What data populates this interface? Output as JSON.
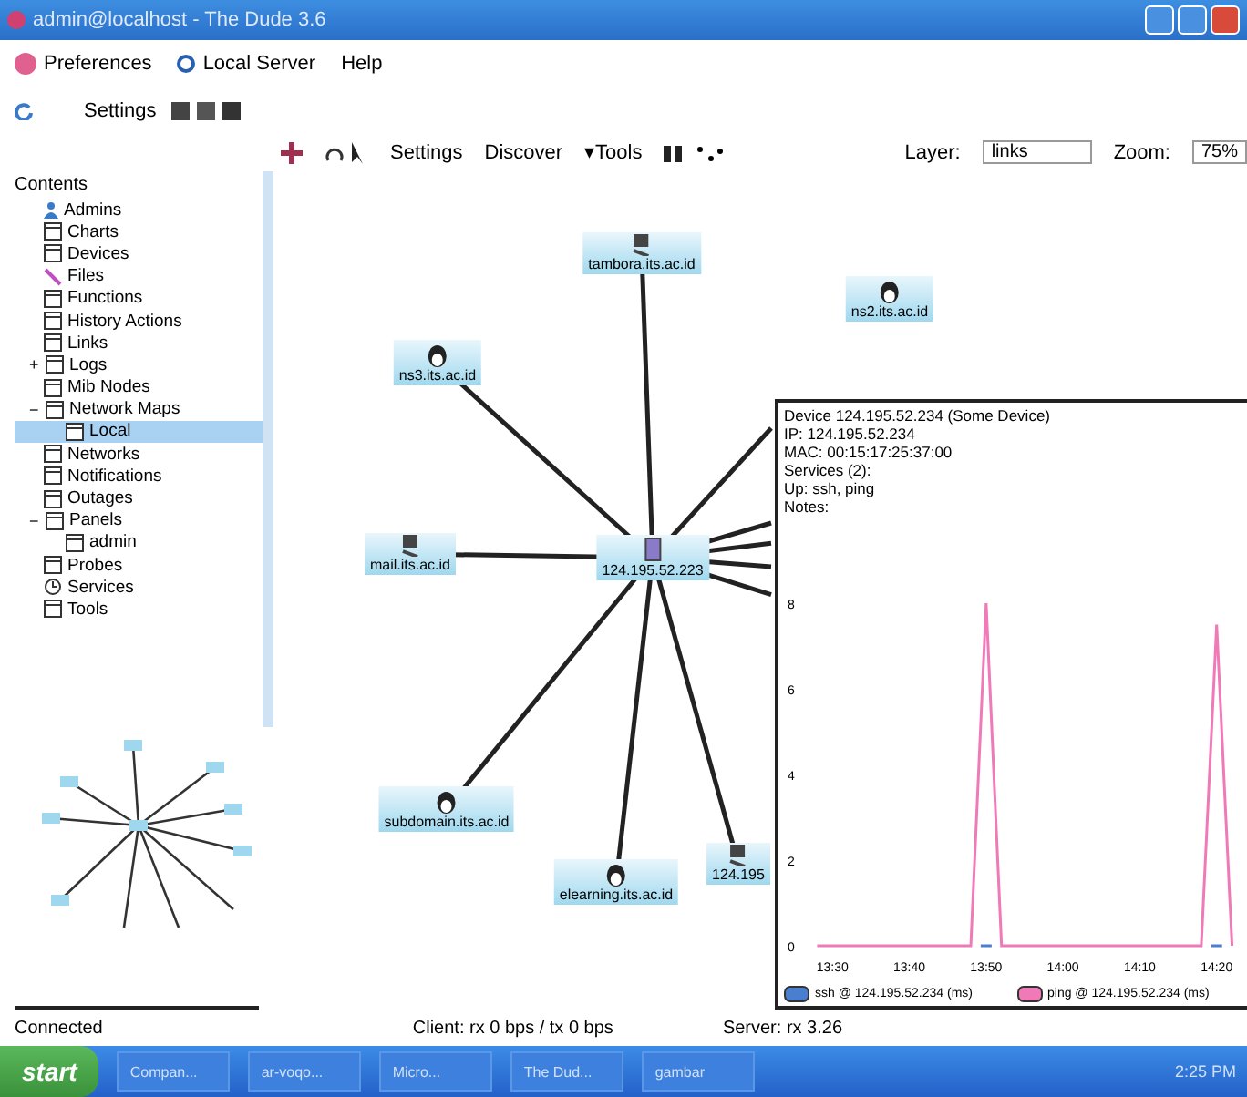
{
  "window": {
    "title": "admin@localhost - The Dude 3.6"
  },
  "menu": [
    {
      "label": "Preferences",
      "kind": "logo"
    },
    {
      "label": "Local Server",
      "kind": "circle"
    },
    {
      "label": "Help",
      "kind": "none"
    }
  ],
  "panel_toolbar": {
    "settings": "Settings"
  },
  "canvas_toolbar": {
    "settings": "Settings",
    "discover": "Discover",
    "tools": "▾Tools",
    "layer_label": "Layer:",
    "layer_value": "links",
    "zoom_label": "Zoom:",
    "zoom_value": "75%"
  },
  "sidebar": {
    "title": "Contents",
    "items": [
      {
        "label": "Admins",
        "kind": "user",
        "selected": false
      },
      {
        "label": "Charts",
        "kind": "table",
        "selected": false
      },
      {
        "label": "Devices",
        "kind": "table",
        "selected": false
      },
      {
        "label": "Files",
        "kind": "file",
        "selected": false
      },
      {
        "label": "Functions",
        "kind": "table",
        "selected": false
      },
      {
        "label": "History Actions",
        "kind": "table",
        "selected": false
      },
      {
        "label": "Links",
        "kind": "table",
        "selected": false
      },
      {
        "label": "Logs",
        "kind": "table",
        "selected": false,
        "toggle": "+"
      },
      {
        "label": "Mib Nodes",
        "kind": "table",
        "selected": false
      },
      {
        "label": "Network Maps",
        "kind": "table",
        "selected": false,
        "toggle": "−",
        "children": [
          {
            "label": "Local",
            "kind": "table",
            "selected": true
          }
        ]
      },
      {
        "label": "Networks",
        "kind": "table",
        "selected": false
      },
      {
        "label": "Notifications",
        "kind": "table",
        "selected": false
      },
      {
        "label": "Outages",
        "kind": "table",
        "selected": false
      },
      {
        "label": "Panels",
        "kind": "table",
        "selected": false,
        "toggle": "−",
        "children": [
          {
            "label": "admin",
            "kind": "table",
            "selected": false
          }
        ]
      },
      {
        "label": "Probes",
        "kind": "table",
        "selected": false
      },
      {
        "label": "Services",
        "kind": "clock",
        "selected": false
      },
      {
        "label": "Tools",
        "kind": "table",
        "selected": false
      }
    ]
  },
  "map": {
    "center": {
      "label": "124.195.52.223",
      "kind": "server"
    },
    "nodes": [
      {
        "label": "tambora.its.ac.id",
        "kind": "pc"
      },
      {
        "label": "ns3.its.ac.id",
        "kind": "linux"
      },
      {
        "label": "ns2.its.ac.id",
        "kind": "linux"
      },
      {
        "label": "mail.its.ac.id",
        "kind": "pc"
      },
      {
        "label": "subdomain.its.ac.id",
        "kind": "linux"
      },
      {
        "label": "elearning.its.ac.id",
        "kind": "linux"
      },
      {
        "label": "124.195",
        "kind": "pc"
      }
    ]
  },
  "popup": {
    "lines": [
      "Device 124.195.52.234 (Some Device)",
      "IP: 124.195.52.234",
      "MAC: 00:15:17:25:37:00",
      "Services (2):",
      "Up: ssh, ping",
      "Notes:"
    ],
    "chart_data": {
      "type": "line",
      "categories": [
        null,
        "13:30",
        null,
        null,
        null,
        null,
        "13:40",
        null,
        null,
        null,
        null,
        "13:50",
        null,
        null,
        null,
        null,
        "14:00",
        null,
        null,
        null,
        null,
        "14:10",
        null,
        null,
        null,
        null,
        "14:20",
        null
      ],
      "series": [
        {
          "name": "ssh @ 124.195.52.234 (ms)",
          "color": "#4a7fd0",
          "values": [
            null,
            null,
            null,
            null,
            null,
            null,
            null,
            null,
            null,
            null,
            null,
            0,
            null,
            null,
            null,
            null,
            null,
            null,
            null,
            null,
            null,
            null,
            null,
            null,
            null,
            null,
            0,
            null
          ]
        },
        {
          "name": "ping @ 124.195.52.234 (ms)",
          "color": "#f07ab8",
          "values": [
            0,
            0,
            0,
            0,
            0,
            0,
            0,
            0,
            0,
            0,
            0,
            8,
            0,
            0,
            0,
            0,
            0,
            0,
            0,
            0,
            0,
            0,
            0,
            0,
            0,
            0,
            7.5,
            0
          ]
        }
      ],
      "ylim": [
        0,
        8
      ],
      "yticks": [
        0,
        2,
        4,
        6,
        8
      ]
    }
  },
  "status_bar": {
    "state": "Connected",
    "client": "Client: rx 0 bps / tx 0 bps",
    "server": "Server: rx 3.26"
  },
  "taskbar": {
    "start": "start",
    "tasks": [
      "Compan...",
      "ar-voqo...",
      "Micro...",
      "The Dud...",
      "gambar"
    ],
    "clock": "2:25 PM"
  }
}
